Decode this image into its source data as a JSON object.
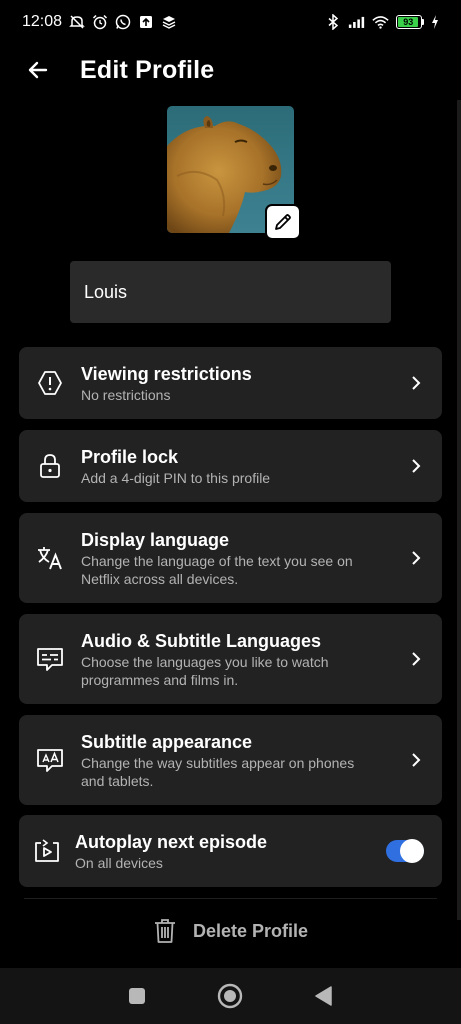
{
  "status_bar": {
    "time": "12:08",
    "battery_level": "93",
    "icons_left": [
      "mute-off-icon",
      "alarm-icon",
      "whatsapp-icon",
      "upload-icon",
      "stack-icon"
    ],
    "icons_right": [
      "bluetooth-icon",
      "signal-icon",
      "wifi-icon",
      "battery-icon",
      "charging-icon"
    ]
  },
  "header": {
    "title": "Edit Profile"
  },
  "profile": {
    "name_value": "Louis"
  },
  "settings": [
    {
      "title": "Viewing restrictions",
      "subtitle": "No restrictions",
      "icon": "warning-octagon-icon"
    },
    {
      "title": "Profile lock",
      "subtitle": "Add a 4-digit PIN to this profile",
      "icon": "lock-icon"
    },
    {
      "title": "Display language",
      "subtitle": "Change the language of the text you see on Netflix across all devices.",
      "icon": "translate-icon"
    },
    {
      "title": "Audio & Subtitle Languages",
      "subtitle": "Choose the languages you like to watch programmes and films in.",
      "icon": "subtitles-icon"
    },
    {
      "title": "Subtitle appearance",
      "subtitle": "Change the way subtitles appear on phones and tablets.",
      "icon": "subtitle-appearance-icon"
    }
  ],
  "autoplay": {
    "title": "Autoplay next episode",
    "subtitle": "On all devices",
    "enabled": true,
    "icon": "autoplay-icon"
  },
  "delete": {
    "label": "Delete Profile"
  },
  "colors": {
    "background": "#000000",
    "card": "#222222",
    "toggle_on": "#2f6fe0",
    "muted_text": "#b3b3b3"
  }
}
